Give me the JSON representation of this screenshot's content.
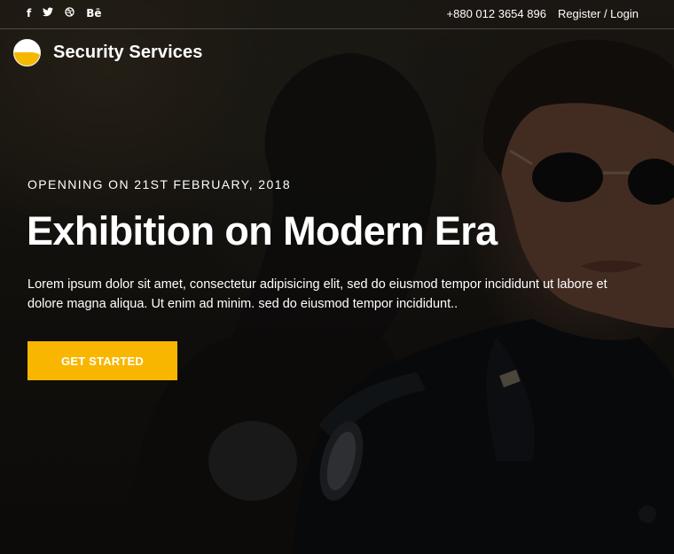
{
  "topbar": {
    "social": [
      {
        "name": "facebook-icon",
        "glyph": "f"
      },
      {
        "name": "twitter-icon",
        "glyph": "🐦"
      },
      {
        "name": "dribbble-icon",
        "glyph": "⊛"
      },
      {
        "name": "behance-icon",
        "glyph": "Bē"
      }
    ],
    "phone": "+880 012 3654 896",
    "auth_link": "Register / Login"
  },
  "brand": {
    "name": "Security Services"
  },
  "hero": {
    "eyebrow": "OPENNING ON 21ST FEBRUARY, 2018",
    "headline": "Exhibition on Modern Era",
    "description": "Lorem ipsum dolor sit amet, consectetur adipisicing elit, sed do eiusmod tempor incididunt ut labore et dolore magna aliqua. Ut enim ad minim. sed do eiusmod tempor incididunt..",
    "cta_label": "GET STARTED"
  },
  "colors": {
    "accent": "#f8b600",
    "text": "#ffffff"
  }
}
